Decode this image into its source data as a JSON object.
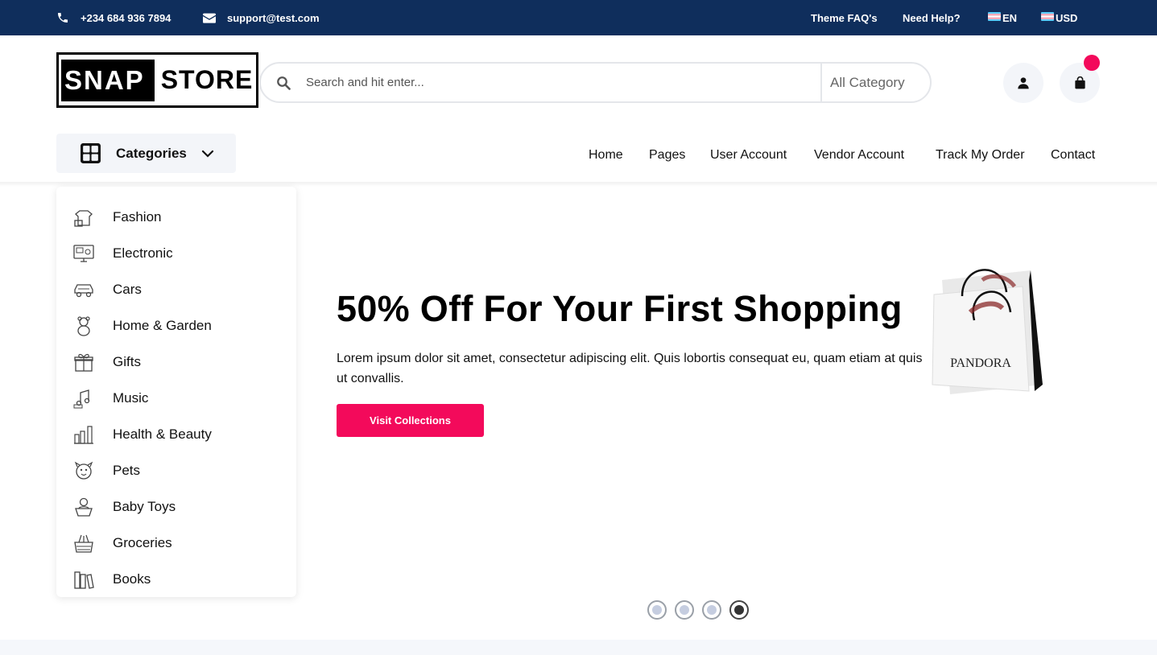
{
  "topbar": {
    "phone": "+234 684 936 7894",
    "email": "support@test.com",
    "faq": "Theme FAQ's",
    "help": "Need Help?",
    "language": "EN",
    "currency": "USD"
  },
  "header": {
    "logo_left": "SNAP",
    "logo_right": "STORE",
    "search_placeholder": "Search and hit enter...",
    "category_select": "All Category"
  },
  "nav": {
    "categories_label": "Categories",
    "links": [
      "Home",
      "Pages",
      "User Account",
      "Vendor Account",
      "Track My Order",
      "Contact"
    ]
  },
  "sidebar": {
    "items": [
      {
        "label": "Fashion",
        "icon": "fashion-icon"
      },
      {
        "label": "Electronic",
        "icon": "electronic-icon"
      },
      {
        "label": "Cars",
        "icon": "car-icon"
      },
      {
        "label": "Home & Garden",
        "icon": "teddy-bear-icon"
      },
      {
        "label": "Gifts",
        "icon": "gift-icon"
      },
      {
        "label": "Music",
        "icon": "music-icon"
      },
      {
        "label": "Health & Beauty",
        "icon": "beauty-icon"
      },
      {
        "label": "Pets",
        "icon": "pets-icon"
      },
      {
        "label": "Baby Toys",
        "icon": "baby-toys-icon"
      },
      {
        "label": "Groceries",
        "icon": "groceries-icon"
      },
      {
        "label": "Books",
        "icon": "books-icon"
      }
    ]
  },
  "hero": {
    "title": "50% Off For Your First Shopping",
    "text": "Lorem ipsum dolor sit amet, consectetur adipiscing elit. Quis lobortis consequat eu, quam etiam at quis ut convallis.",
    "button": "Visit Collections",
    "bag_brand": "PANDORA",
    "slides_total": 4,
    "active_slide": 4
  },
  "colors": {
    "topbar": "#0f2e5c",
    "accent": "#f30a5b",
    "light_bg": "#f3f5f9"
  }
}
